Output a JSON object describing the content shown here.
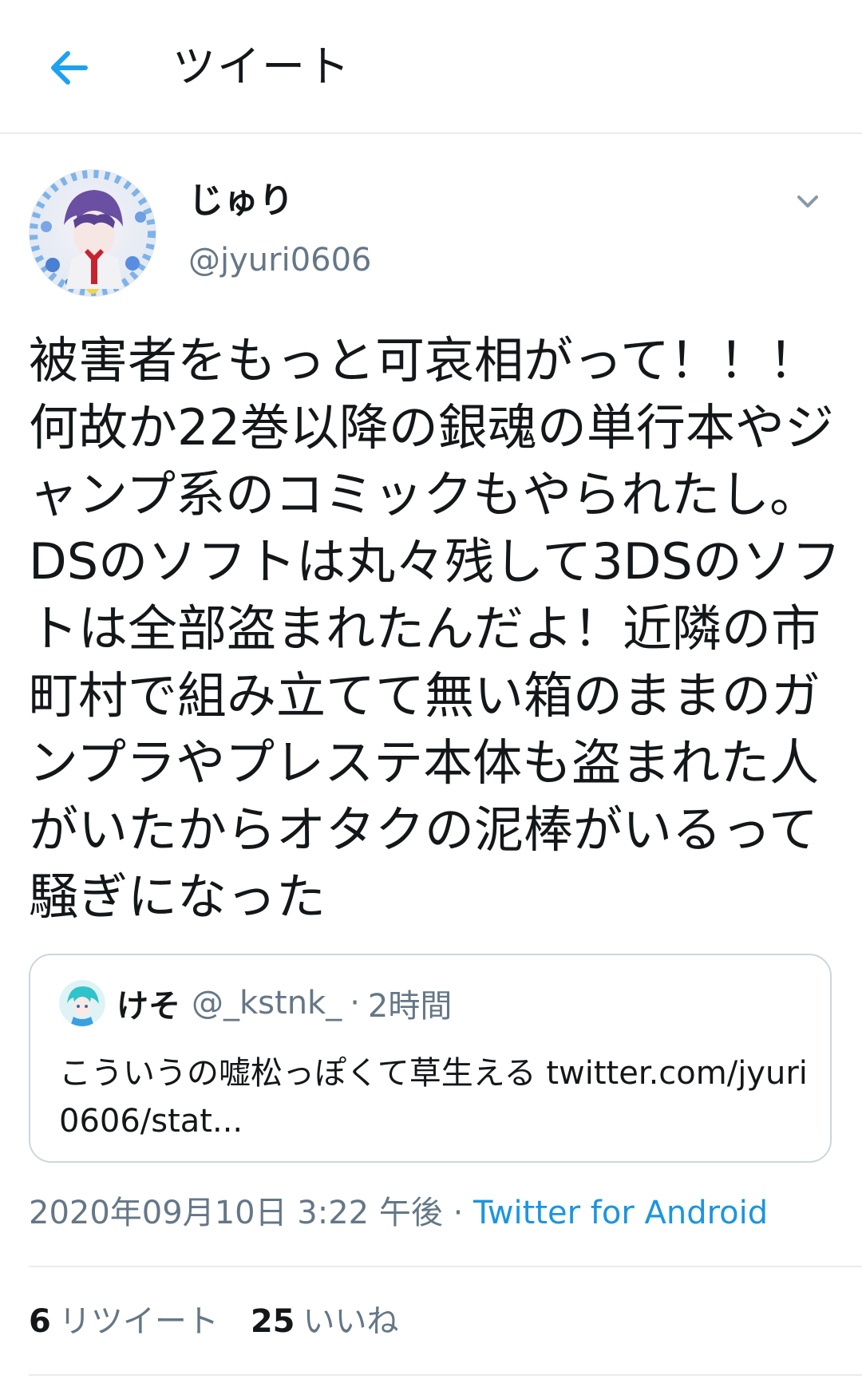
{
  "header": {
    "title": "ツイート",
    "back_icon": "arrow-left-icon"
  },
  "author": {
    "display_name": "じゅり",
    "handle": "@jyuri0606",
    "menu_icon": "chevron-down-icon"
  },
  "tweet": {
    "text": "被害者をもっと可哀相がって！！！何故か22巻以降の銀魂の単行本やジャンプ系のコミックもやられたし。DSのソフトは丸々残して3DSのソフトは全部盗まれたんだよ！近隣の市町村で組み立てて無い箱のままのガンプラやプレステ本体も盗まれた人がいたからオタクの泥棒がいるって騒ぎになった"
  },
  "quote": {
    "name": "けそ",
    "handle": "@_kstnk_",
    "separator": "·",
    "time": "2時間",
    "text": "こういうの嘘松っぽくて草生える twitter.com/jyuri0606/stat..."
  },
  "meta": {
    "timestamp": "2020年09月10日 3:22 午後",
    "separator": "·",
    "source": "Twitter for Android"
  },
  "stats": {
    "retweets_count": "6",
    "retweets_label": "リツイート",
    "likes_count": "25",
    "likes_label": "いいね"
  },
  "colors": {
    "accent": "#1b95e0",
    "secondary_text": "#657786",
    "border": "#e6ecf0"
  }
}
